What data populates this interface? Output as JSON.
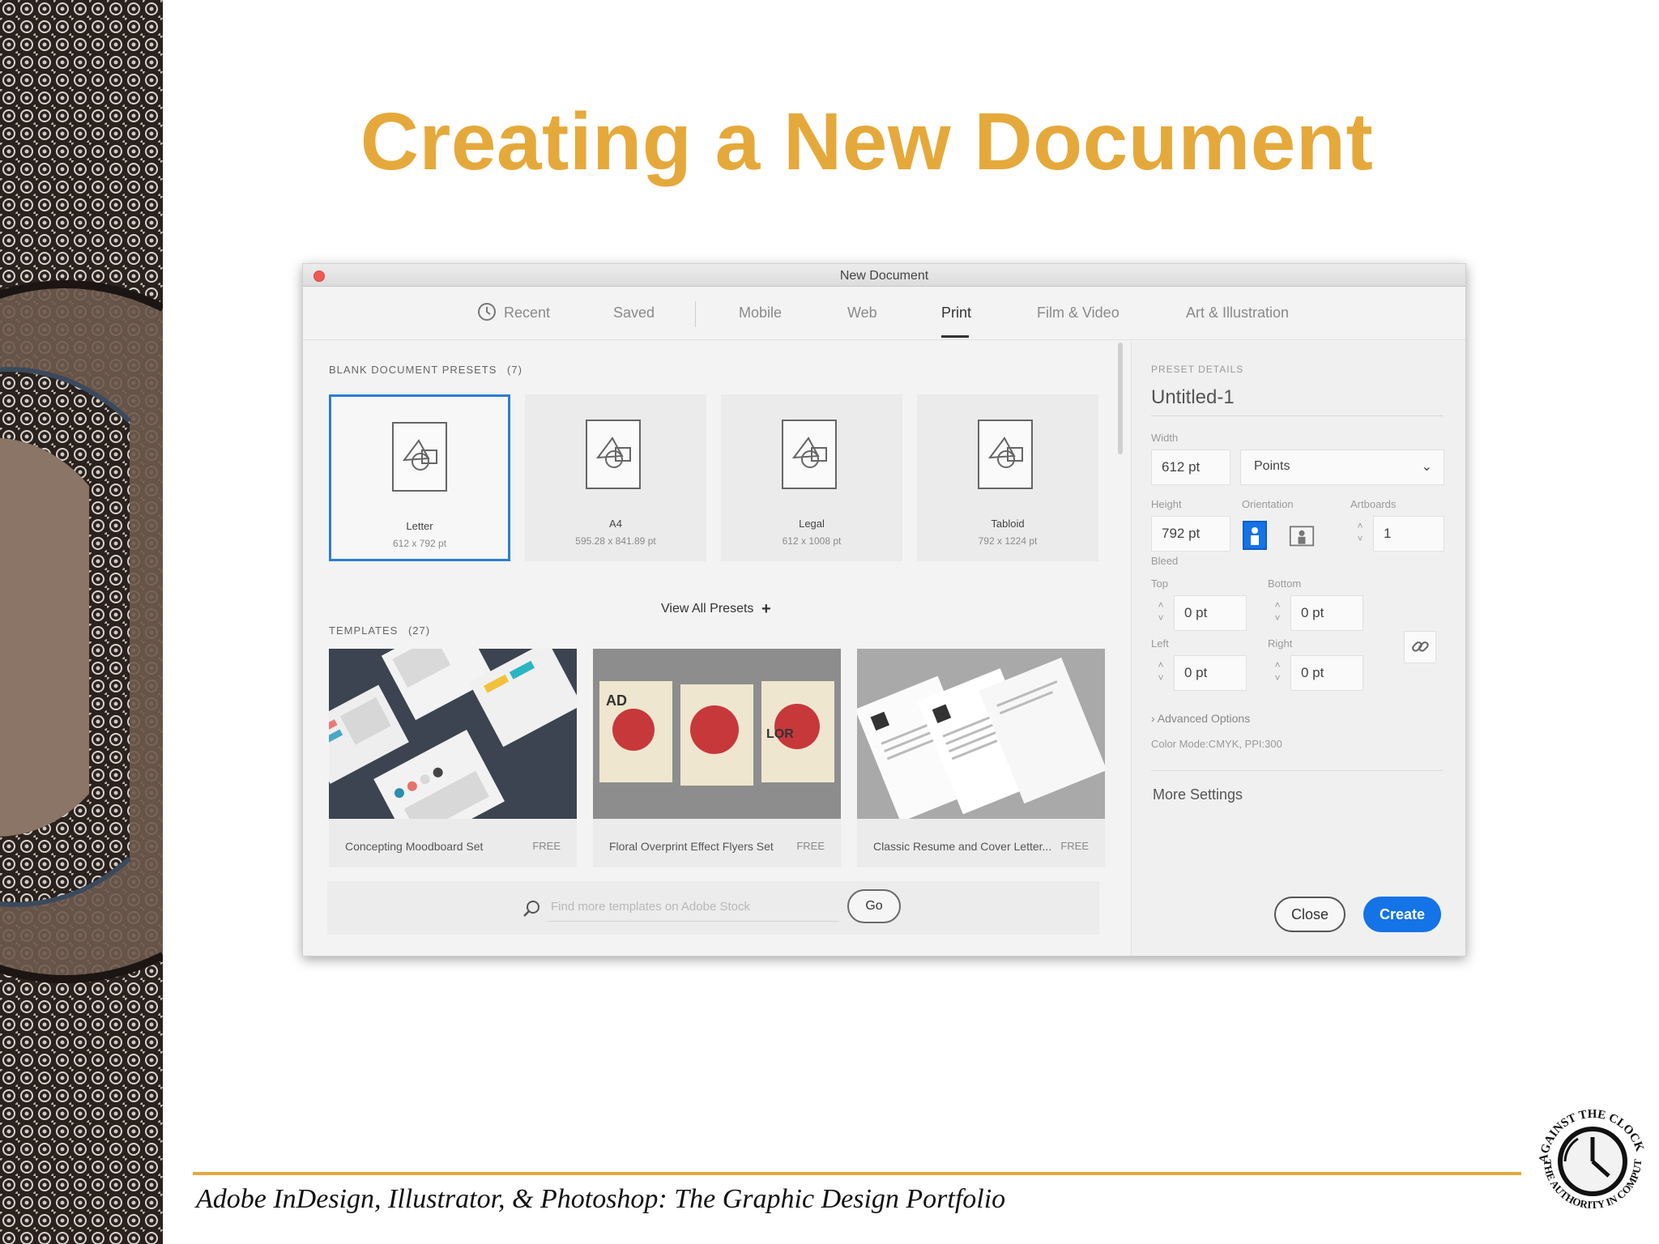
{
  "slide": {
    "title": "Creating a New Document",
    "footer": "Adobe InDesign, Illustrator, & Photoshop: The Graphic Design Portfolio",
    "logo_text_top": "AGAINST THE CLOCK",
    "logo_text_bottom": "THE AUTHORITY IN COMPUTER"
  },
  "dialog": {
    "window_title": "New Document",
    "tabs": [
      {
        "label": "Recent",
        "active": false
      },
      {
        "label": "Saved",
        "active": false
      },
      {
        "label": "Mobile",
        "active": false
      },
      {
        "label": "Web",
        "active": false
      },
      {
        "label": "Print",
        "active": true
      },
      {
        "label": "Film & Video",
        "active": false
      },
      {
        "label": "Art & Illustration",
        "active": false
      }
    ],
    "presets_header": "BLANK DOCUMENT PRESETS",
    "presets_count": "(7)",
    "presets": [
      {
        "name": "Letter",
        "dims": "612 x 792 pt",
        "selected": true
      },
      {
        "name": "A4",
        "dims": "595.28 x 841.89 pt",
        "selected": false
      },
      {
        "name": "Legal",
        "dims": "612 x 1008 pt",
        "selected": false
      },
      {
        "name": "Tabloid",
        "dims": "792 x 1224 pt",
        "selected": false
      }
    ],
    "view_all": "View All Presets",
    "templates_header": "TEMPLATES",
    "templates_count": "(27)",
    "templates": [
      {
        "name": "Concepting Moodboard Set",
        "price": "FREE"
      },
      {
        "name": "Floral Overprint Effect Flyers Set",
        "price": "FREE"
      },
      {
        "name": "Classic Resume and Cover Letter...",
        "price": "FREE"
      }
    ],
    "search": {
      "placeholder": "Find more templates on Adobe Stock",
      "go_label": "Go"
    },
    "details": {
      "header": "PRESET DETAILS",
      "doc_name": "Untitled-1",
      "width_label": "Width",
      "width_value": "612 pt",
      "units": "Points",
      "height_label": "Height",
      "height_value": "792 pt",
      "orientation_label": "Orientation",
      "artboards_label": "Artboards",
      "artboards_value": "1",
      "bleed_label": "Bleed",
      "top_label": "Top",
      "top_value": "0 pt",
      "bottom_label": "Bottom",
      "bottom_value": "0 pt",
      "left_label": "Left",
      "left_value": "0 pt",
      "right_label": "Right",
      "right_value": "0 pt",
      "advanced": "Advanced Options",
      "color_mode": "Color Mode:CMYK, PPI:300",
      "more_settings": "More Settings",
      "close_label": "Close",
      "create_label": "Create"
    }
  },
  "colors": {
    "title": "#e5a93b",
    "accent_blue": "#1473e6",
    "selection_border": "#2a7fd4"
  }
}
